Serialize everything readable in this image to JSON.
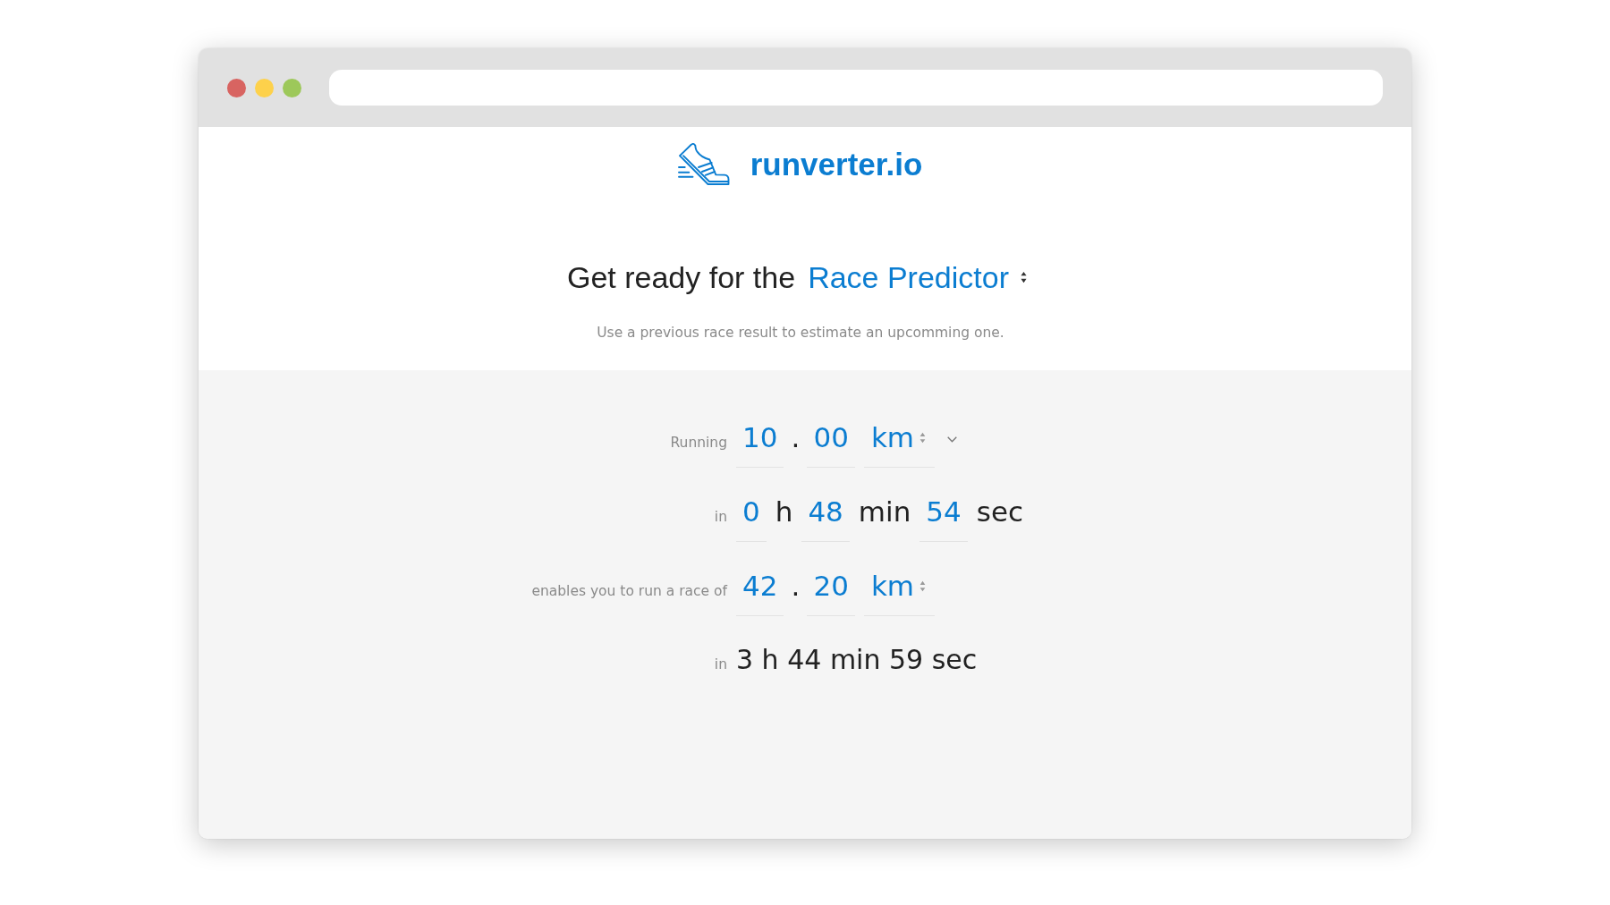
{
  "window_controls": [
    {
      "kind": "close",
      "color": "#d86461"
    },
    {
      "kind": "minimize",
      "color": "#fdd14b"
    },
    {
      "kind": "zoom",
      "color": "#9dc85a"
    }
  ],
  "logo": {
    "text": "runverter.io"
  },
  "heading": {
    "text": "Get ready for the",
    "mode": "Race Predictor"
  },
  "subtitle": "Use a previous race result to estimate an upcomming one.",
  "form": {
    "rows": [
      {
        "kind": "distance",
        "label": "Running",
        "whole": "10",
        "separator": ".",
        "fraction": "00",
        "unit": "km",
        "dropdown": true
      },
      {
        "kind": "time",
        "label": "in",
        "parts": [
          {
            "value": "0",
            "unit": "h"
          },
          {
            "value": "48",
            "unit": "min"
          },
          {
            "value": "54",
            "unit": "sec"
          }
        ]
      },
      {
        "kind": "distance",
        "label": "enables you to run a race of",
        "whole": "42",
        "separator": ".",
        "fraction": "20",
        "unit": "km",
        "dropdown": false
      },
      {
        "kind": "result",
        "label": "in",
        "value": "3 h 44 min 59 sec"
      }
    ]
  }
}
